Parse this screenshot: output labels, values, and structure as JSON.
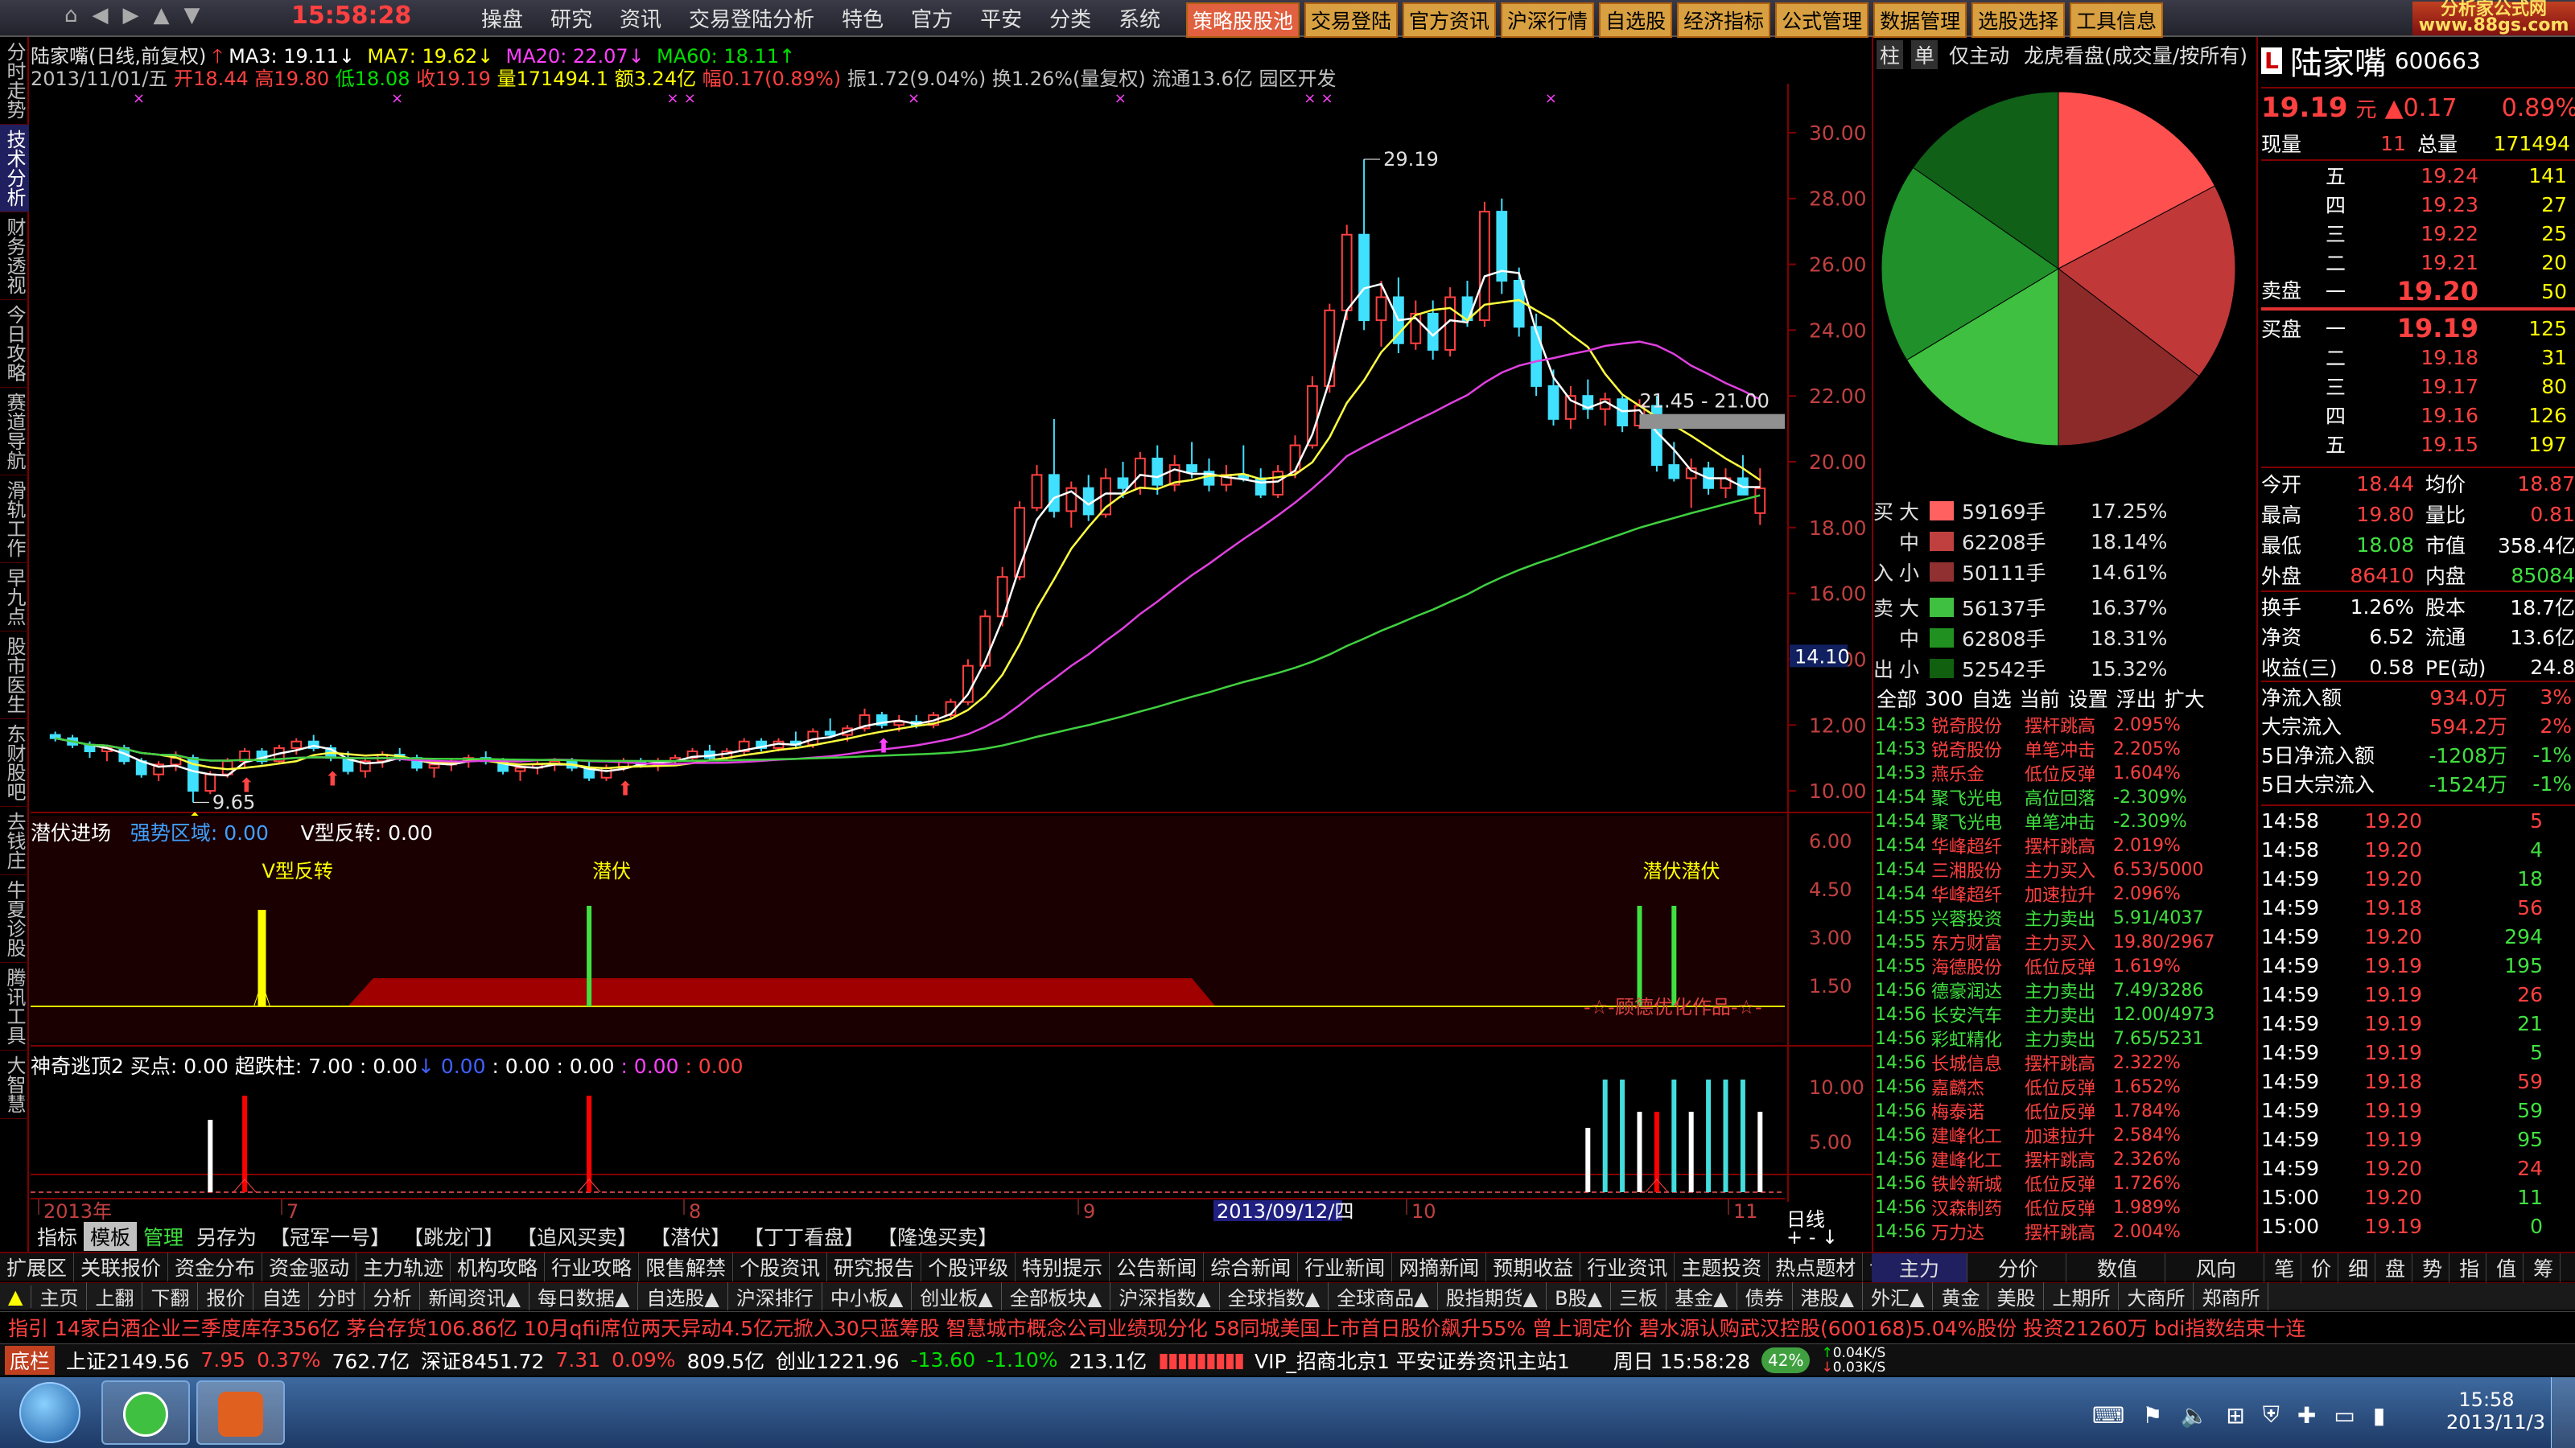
{
  "topbar": {
    "clock": "15:58:28",
    "menu": [
      "操盘",
      "研究",
      "资讯",
      "交易登陆分析",
      "特色",
      "官方",
      "平安",
      "分类",
      "系统"
    ],
    "tabs": [
      "策略股股池",
      "交易登陆",
      "官方资讯",
      "沪深行情",
      "自选股",
      "经济指标",
      "公式管理",
      "数据管理",
      "选股选择",
      "工具信息"
    ],
    "logo": "分析家公式网 www.88gs.com"
  },
  "leftnav": [
    "分时走势",
    "技术分析",
    "财务透视",
    "今日攻略",
    "赛道导航",
    "滑轨工作",
    "早九点",
    "股市医生",
    "东财股吧",
    "去钱庄",
    "牛夏诊股",
    "腾讯工具",
    "大智慧"
  ],
  "chart": {
    "title": "陆家嘴(日线,前复权)",
    "ma3": "MA3: 19.11",
    "ma7": "MA7: 19.62",
    "ma20": "MA20: 22.07",
    "ma60": "MA60: 18.11",
    "info_date": "2013/11/01/五",
    "info_open": "开18.44",
    "info_high": "高19.80",
    "info_low": "低18.08",
    "info_close": "收19.19",
    "info_vol": "量171494.1",
    "info_amt": "额3.24亿",
    "info_chg": "幅0.17(0.89%)",
    "info_rest": "振1.72(9.04%) 换1.26%(量复权) 流通13.6亿 园区开发",
    "price_ticks": [
      "30.00",
      "28.00",
      "26.00",
      "24.00",
      "22.00",
      "20.00",
      "18.00",
      "16.00",
      "14.00",
      "12.00",
      "10.00"
    ],
    "hl_label": "29.19",
    "low_label": "9.65",
    "range_label": "21.45 - 21.00",
    "cursor_price": "14.10",
    "panel2_title": "潜伏进场",
    "panel2_strong": "强势区域: 0.00",
    "panel2_v": "V型反转: 0.00",
    "panel2_ticks": [
      "6.00",
      "4.50",
      "3.00",
      "1.50"
    ],
    "panel2_labels": [
      "V型反转",
      "潜伏",
      "潜伏潜伏"
    ],
    "panel2_credit": "-☆-顾德优化作品-☆-",
    "panel3_title": "神奇逃顶2",
    "panel3_buy": "买点: 0.00",
    "panel3_pillar": "超跌柱: 7.00",
    "panel3_v1": ": 0.00",
    "panel3_v2": "0.00",
    "panel3_v3": ": 0.00",
    "panel3_v4": ": 0.00",
    "panel3_v5": ": 0.00",
    "panel3_v6": ": 0.00",
    "panel3_ticks": [
      "10.00",
      "5.00"
    ],
    "xaxis": [
      "2013年",
      "7",
      "8",
      "9",
      "10",
      "11"
    ],
    "x_cursor": "2013/09/12/四",
    "period": "日线"
  },
  "subtabs": [
    "指标",
    "模板",
    "管理",
    "另存为",
    "【冠军一号】",
    "【跳龙门】",
    "【追风买卖】",
    "【潜伏】",
    "【丁丁看盘】",
    "【隆逸买卖】"
  ],
  "funcbar": [
    "扩展区",
    "关联报价",
    "资金分布",
    "资金驱动",
    "主力轨迹",
    "机构攻略",
    "行业攻略",
    "限售解禁",
    "个股资讯",
    "研究报告",
    "个股评级",
    "特别提示",
    "公告新闻",
    "综合新闻",
    "行业新闻",
    "网摘新闻",
    "预期收益",
    "行业资讯",
    "主题投资",
    "热点题材",
    "切换"
  ],
  "funcbar_right": [
    "主力",
    "分价",
    "数值",
    "风向",
    "笔",
    "价",
    "细",
    "盘",
    "势",
    "指",
    "值",
    "筹"
  ],
  "navbar2": [
    "主页",
    "上翻",
    "下翻",
    "报价",
    "自选",
    "分时",
    "分析",
    "新闻资讯▲",
    "每日数据▲",
    "自选股▲",
    "沪深排行",
    "中小板▲",
    "创业板▲",
    "全部板块▲",
    "沪深指数▲",
    "全球指数▲",
    "全球商品▲",
    "股指期货▲",
    "B股▲",
    "三板",
    "基金▲",
    "债券",
    "港股▲",
    "外汇▲",
    "黄金",
    "美股",
    "上期所",
    "大商所",
    "郑商所"
  ],
  "ticker": "指引  14家白酒企业三季度库存356亿  茅台存货106.86亿    10月qfii席位两天异动4.5亿元掀入30只蓝筹股    智慧城市概念公司业绩现分化    58同城美国上市首日股价飙升55% 曾上调定价    碧水源认购武汉控股(600168)5.04%股份 投资21260万    bdi指数结束十连",
  "status": {
    "label": "底栏",
    "sh": "上证2149.56",
    "sh_chg": "7.95",
    "sh_pct": "0.37%",
    "sh_amt": "762.7亿",
    "sz": "深证8451.72",
    "sz_chg": "7.31",
    "sz_pct": "0.09%",
    "sz_amt": "809.5亿",
    "cy": "创业1221.96",
    "cy_chg": "-13.60",
    "cy_pct": "-1.10%",
    "cy_amt": "213.1亿",
    "conn": "VIP_招商北京1  平安证券资讯主站1",
    "day": "周日  15:58:28",
    "net_pct": "42%",
    "up": "0.04K/S",
    "down": "0.03K/S"
  },
  "taskbar": {
    "time": "15:58",
    "date": "2013/11/3"
  },
  "rp": {
    "tabs": [
      "柱",
      "单",
      "仅主动",
      "龙虎看盘(成交量/按所有)"
    ],
    "flow_buy": [
      {
        "s": "大",
        "v": "59169手",
        "p": "17.25%",
        "c": "#ff6060"
      },
      {
        "s": "中",
        "v": "62208手",
        "p": "18.14%",
        "c": "#c04040"
      },
      {
        "s": "小",
        "v": "50111手",
        "p": "14.61%",
        "c": "#903030"
      }
    ],
    "flow_sell": [
      {
        "s": "大",
        "v": "56137手",
        "p": "16.37%",
        "c": "#40c040"
      },
      {
        "s": "中",
        "v": "62808手",
        "p": "18.31%",
        "c": "#209020"
      },
      {
        "s": "小",
        "v": "52542手",
        "p": "15.32%",
        "c": "#106010"
      }
    ],
    "flow_side_buy": [
      "买",
      "入"
    ],
    "flow_side_sell": [
      "卖",
      "出"
    ],
    "filter": [
      "全部",
      "300",
      "自选",
      "当前",
      "设置",
      "浮出",
      "扩大"
    ],
    "news": [
      [
        "14:53",
        "锐奇股份",
        "摆杆跳高",
        "2.095%"
      ],
      [
        "14:53",
        "锐奇股份",
        "单笔冲击",
        "2.205%"
      ],
      [
        "14:53",
        "燕乐金",
        "低位反弹",
        "1.604%"
      ],
      [
        "14:54",
        "聚飞光电",
        "高位回落",
        "-2.309%"
      ],
      [
        "14:54",
        "聚飞光电",
        "单笔冲击",
        "-2.309%"
      ],
      [
        "14:54",
        "华峰超纤",
        "摆杆跳高",
        "2.019%"
      ],
      [
        "14:54",
        "三湘股份",
        "主力买入",
        "6.53/5000"
      ],
      [
        "14:54",
        "华峰超纤",
        "加速拉升",
        "2.096%"
      ],
      [
        "14:55",
        "兴蓉投资",
        "主力卖出",
        "5.91/4037"
      ],
      [
        "14:55",
        "东方财富",
        "主力买入",
        "19.80/2967"
      ],
      [
        "14:55",
        "海德股份",
        "低位反弹",
        "1.619%"
      ],
      [
        "14:56",
        "德豪润达",
        "主力卖出",
        "7.49/3286"
      ],
      [
        "14:56",
        "长安汽车",
        "主力卖出",
        "12.00/4973"
      ],
      [
        "14:56",
        "彩虹精化",
        "主力卖出",
        "7.65/5231"
      ],
      [
        "14:56",
        "长城信息",
        "摆杆跳高",
        "2.322%"
      ],
      [
        "14:56",
        "嘉麟杰",
        "低位反弹",
        "1.652%"
      ],
      [
        "14:56",
        "梅泰诺",
        "低位反弹",
        "1.784%"
      ],
      [
        "14:56",
        "建峰化工",
        "加速拉升",
        "2.584%"
      ],
      [
        "14:56",
        "建峰化工",
        "摆杆跳高",
        "2.326%"
      ],
      [
        "14:56",
        "铁岭新城",
        "低位反弹",
        "1.726%"
      ],
      [
        "14:56",
        "汉森制药",
        "低位反弹",
        "1.989%"
      ],
      [
        "14:56",
        "万力达",
        "摆杆跳高",
        "2.004%"
      ]
    ],
    "stock_name": "陆家嘴",
    "stock_code": "600663",
    "price": "19.19",
    "price_unit": "元",
    "chg": "▲0.17",
    "pct": "0.89%",
    "now_lbl": "现量",
    "now_v": "11",
    "tot_lbl": "总量",
    "tot_v": "171494",
    "sell_lbl": "卖盘",
    "buy_lbl": "买盘",
    "asks": [
      [
        "五",
        "19.24",
        "141"
      ],
      [
        "四",
        "19.23",
        "27"
      ],
      [
        "三",
        "19.22",
        "25"
      ],
      [
        "二",
        "19.21",
        "20"
      ],
      [
        "一",
        "19.20",
        "50"
      ]
    ],
    "bids": [
      [
        "一",
        "19.19",
        "125"
      ],
      [
        "二",
        "19.18",
        "31"
      ],
      [
        "三",
        "19.17",
        "80"
      ],
      [
        "四",
        "19.16",
        "126"
      ],
      [
        "五",
        "19.15",
        "197"
      ]
    ],
    "stats": [
      [
        "今开",
        "18.44",
        "均价",
        "18.87"
      ],
      [
        "最高",
        "19.80",
        "量比",
        "0.81"
      ],
      [
        "最低",
        "18.08",
        "市值",
        "358.4亿"
      ],
      [
        "外盘",
        "86410",
        "内盘",
        "85084"
      ],
      [
        "换手",
        "1.26%",
        "股本",
        "18.7亿"
      ],
      [
        "净资",
        "6.52",
        "流通",
        "13.6亿"
      ],
      [
        "收益(三)",
        "0.58",
        "PE(动)",
        "24.8"
      ]
    ],
    "flows": [
      [
        "净流入额",
        "934.0万",
        "3%"
      ],
      [
        "大宗流入",
        "594.2万",
        "2%"
      ],
      [
        "5日净流入额",
        "-1208万",
        "-1%"
      ],
      [
        "5日大宗流入",
        "-1524万",
        "-1%"
      ]
    ],
    "ticks": [
      [
        "14:58",
        "19.20",
        "5"
      ],
      [
        "14:58",
        "19.20",
        "4"
      ],
      [
        "14:59",
        "19.20",
        "18"
      ],
      [
        "14:59",
        "19.18",
        "56"
      ],
      [
        "14:59",
        "19.20",
        "294"
      ],
      [
        "14:59",
        "19.19",
        "195"
      ],
      [
        "14:59",
        "19.19",
        "26"
      ],
      [
        "14:59",
        "19.19",
        "21"
      ],
      [
        "14:59",
        "19.19",
        "5"
      ],
      [
        "14:59",
        "19.18",
        "59"
      ],
      [
        "14:59",
        "19.19",
        "59"
      ],
      [
        "14:59",
        "19.19",
        "95"
      ],
      [
        "14:59",
        "19.20",
        "24"
      ],
      [
        "15:00",
        "19.20",
        "11"
      ],
      [
        "15:00",
        "19.19",
        "0"
      ]
    ]
  },
  "chart_data": {
    "type": "candlestick",
    "title": "陆家嘴(日线,前复权)",
    "ylim": [
      9,
      31
    ],
    "xlabel": "",
    "ylabel": "",
    "pie": {
      "type": "pie",
      "slices": [
        {
          "name": "买入大",
          "value": 17.25,
          "color": "#ff5050"
        },
        {
          "name": "买入中",
          "value": 18.14,
          "color": "#c03838"
        },
        {
          "name": "买入小",
          "value": 14.61,
          "color": "#8c2a2a"
        },
        {
          "name": "卖出大",
          "value": 16.37,
          "color": "#40c040"
        },
        {
          "name": "卖出中",
          "value": 18.31,
          "color": "#20902a"
        },
        {
          "name": "卖出小",
          "value": 15.32,
          "color": "#106018"
        }
      ]
    },
    "candles": [
      [
        11.7,
        11.8,
        11.5,
        11.6
      ],
      [
        11.6,
        11.7,
        11.3,
        11.4
      ],
      [
        11.4,
        11.5,
        11.0,
        11.2
      ],
      [
        11.2,
        11.4,
        10.9,
        11.3
      ],
      [
        11.3,
        11.4,
        10.8,
        10.9
      ],
      [
        10.9,
        11.0,
        10.4,
        10.5
      ],
      [
        10.5,
        10.9,
        10.3,
        10.8
      ],
      [
        10.8,
        11.2,
        10.6,
        11.0
      ],
      [
        11.0,
        11.1,
        9.65,
        10.0
      ],
      [
        10.0,
        10.6,
        9.9,
        10.5
      ],
      [
        10.5,
        11.0,
        10.4,
        10.9
      ],
      [
        10.9,
        11.3,
        10.7,
        11.2
      ],
      [
        11.2,
        11.3,
        10.8,
        10.9
      ],
      [
        10.9,
        11.4,
        10.8,
        11.3
      ],
      [
        11.3,
        11.6,
        11.1,
        11.5
      ],
      [
        11.5,
        11.7,
        11.2,
        11.3
      ],
      [
        11.3,
        11.4,
        10.9,
        11.0
      ],
      [
        11.0,
        11.2,
        10.5,
        10.6
      ],
      [
        10.6,
        11.0,
        10.4,
        10.9
      ],
      [
        10.9,
        11.2,
        10.7,
        11.1
      ],
      [
        11.1,
        11.3,
        10.9,
        11.0
      ],
      [
        11.0,
        11.1,
        10.6,
        10.7
      ],
      [
        10.7,
        10.9,
        10.4,
        10.8
      ],
      [
        10.8,
        11.0,
        10.6,
        10.9
      ],
      [
        10.9,
        11.1,
        10.7,
        11.0
      ],
      [
        11.0,
        11.2,
        10.8,
        10.9
      ],
      [
        10.9,
        11.0,
        10.5,
        10.6
      ],
      [
        10.6,
        10.8,
        10.3,
        10.7
      ],
      [
        10.7,
        10.9,
        10.5,
        10.8
      ],
      [
        10.8,
        11.0,
        10.6,
        10.9
      ],
      [
        10.9,
        11.0,
        10.6,
        10.7
      ],
      [
        10.7,
        10.9,
        10.3,
        10.4
      ],
      [
        10.4,
        10.8,
        10.3,
        10.7
      ],
      [
        10.7,
        11.0,
        10.6,
        10.9
      ],
      [
        10.9,
        11.0,
        10.7,
        10.8
      ],
      [
        10.8,
        11.0,
        10.6,
        10.9
      ],
      [
        10.9,
        11.1,
        10.8,
        11.0
      ],
      [
        11.0,
        11.3,
        10.9,
        11.2
      ],
      [
        11.2,
        11.4,
        10.9,
        11.0
      ],
      [
        11.0,
        11.3,
        10.9,
        11.2
      ],
      [
        11.2,
        11.6,
        11.1,
        11.5
      ],
      [
        11.5,
        11.6,
        11.2,
        11.3
      ],
      [
        11.3,
        11.6,
        11.2,
        11.5
      ],
      [
        11.5,
        11.8,
        11.3,
        11.4
      ],
      [
        11.4,
        11.9,
        11.3,
        11.8
      ],
      [
        11.8,
        12.2,
        11.6,
        11.7
      ],
      [
        11.7,
        12.0,
        11.5,
        11.9
      ],
      [
        11.9,
        12.5,
        11.8,
        12.3
      ],
      [
        12.3,
        12.4,
        11.9,
        12.0
      ],
      [
        12.0,
        12.3,
        11.8,
        12.1
      ],
      [
        12.1,
        12.3,
        11.9,
        12.0
      ],
      [
        12.0,
        12.4,
        11.9,
        12.3
      ],
      [
        12.3,
        12.8,
        12.2,
        12.7
      ],
      [
        12.7,
        14.0,
        12.6,
        13.8
      ],
      [
        13.8,
        15.5,
        13.7,
        15.3
      ],
      [
        15.3,
        16.8,
        15.0,
        16.5
      ],
      [
        16.5,
        18.8,
        16.4,
        18.6
      ],
      [
        18.6,
        19.9,
        18.5,
        19.6
      ],
      [
        19.6,
        21.3,
        18.3,
        18.5
      ],
      [
        18.5,
        19.4,
        18.0,
        19.2
      ],
      [
        19.2,
        19.6,
        18.2,
        18.4
      ],
      [
        18.4,
        19.8,
        18.3,
        19.5
      ],
      [
        19.5,
        20.0,
        18.9,
        19.2
      ],
      [
        19.2,
        20.3,
        19.0,
        20.1
      ],
      [
        20.1,
        20.5,
        19.0,
        19.3
      ],
      [
        19.3,
        20.2,
        19.1,
        19.9
      ],
      [
        19.9,
        20.6,
        19.5,
        19.7
      ],
      [
        19.7,
        20.1,
        19.1,
        19.3
      ],
      [
        19.3,
        19.9,
        19.1,
        19.6
      ],
      [
        19.6,
        20.5,
        19.4,
        19.5
      ],
      [
        19.5,
        19.8,
        18.9,
        19.0
      ],
      [
        19.0,
        19.9,
        18.9,
        19.7
      ],
      [
        19.7,
        20.8,
        19.5,
        20.5
      ],
      [
        20.5,
        22.6,
        20.4,
        22.3
      ],
      [
        22.3,
        24.8,
        22.1,
        24.6
      ],
      [
        24.6,
        27.2,
        24.3,
        26.9
      ],
      [
        26.9,
        29.19,
        24.0,
        24.3
      ],
      [
        24.3,
        25.5,
        23.5,
        25.0
      ],
      [
        25.0,
        25.6,
        23.3,
        23.6
      ],
      [
        23.6,
        24.9,
        23.4,
        24.5
      ],
      [
        24.5,
        24.9,
        23.1,
        23.4
      ],
      [
        23.4,
        25.3,
        23.2,
        25.0
      ],
      [
        25.0,
        25.5,
        24.1,
        24.3
      ],
      [
        24.3,
        27.9,
        24.1,
        27.6
      ],
      [
        27.6,
        28.0,
        25.1,
        25.5
      ],
      [
        25.5,
        25.9,
        23.8,
        24.1
      ],
      [
        24.1,
        24.5,
        22.0,
        22.3
      ],
      [
        22.3,
        22.8,
        21.1,
        21.3
      ],
      [
        21.3,
        22.3,
        21.0,
        22.0
      ],
      [
        22.0,
        22.5,
        21.3,
        21.6
      ],
      [
        21.6,
        22.1,
        21.1,
        21.9
      ],
      [
        21.9,
        22.0,
        20.9,
        21.1
      ],
      [
        21.1,
        21.9,
        21.0,
        21.7
      ],
      [
        21.7,
        22.0,
        19.7,
        19.9
      ],
      [
        19.9,
        20.6,
        19.4,
        19.5
      ],
      [
        19.5,
        20.1,
        18.6,
        19.8
      ],
      [
        19.8,
        20.0,
        19.0,
        19.2
      ],
      [
        19.2,
        19.8,
        18.9,
        19.5
      ],
      [
        19.5,
        20.2,
        19.1,
        19.0
      ],
      [
        18.44,
        19.8,
        18.08,
        19.19
      ]
    ],
    "ma_lines": [
      "MA3",
      "MA7",
      "MA20",
      "MA60"
    ]
  }
}
